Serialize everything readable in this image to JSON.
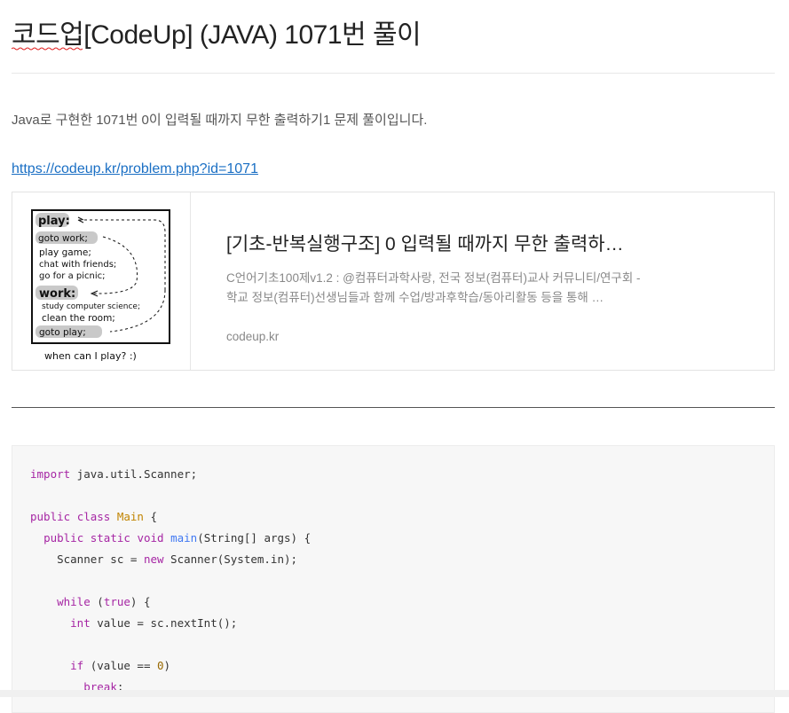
{
  "post": {
    "title": "코드업[CodeUp] (JAVA) 1071번 풀이",
    "intro": "Java로 구현한 1071번 0이 입력될 때까지 무한 출력하기1 문제 풀이입니다.",
    "link": "https://codeup.kr/problem.php?id=1071"
  },
  "card": {
    "title": "[기초-반복실행구조] 0 입력될 때까지 무한 출력하…",
    "desc": "C언어기초100제v1.2 : @컴퓨터과학사랑, 전국 정보(컴퓨터)교사 커뮤니티/연구회 - 학교 정보(컴퓨터)선생님들과 함께 수업/방과후학습/동아리활동 등을 통해 …",
    "domain": "codeup.kr",
    "thumb": {
      "l1": "play:",
      "l2": "goto work;",
      "l3": "play game;",
      "l4": "chat with friends;",
      "l5": "go for a picnic;",
      "l6": "work:",
      "l7": "study computer science;",
      "l8": "clean the room;",
      "l9": "goto play;",
      "caption": "when can I play? :)"
    }
  },
  "code": {
    "language": "java",
    "lines": [
      "import java.util.Scanner;",
      "",
      "public class Main {",
      "  public static void main(String[] args) {",
      "    Scanner sc = new Scanner(System.in);",
      "",
      "    while (true) {",
      "      int value = sc.nextInt();",
      "",
      "      if (value == 0)",
      "        break;"
    ]
  },
  "colors": {
    "link": "#1a6fc4",
    "keyword": "#a626a4",
    "class_name": "#c18401",
    "function": "#4078f2",
    "number": "#986801"
  }
}
